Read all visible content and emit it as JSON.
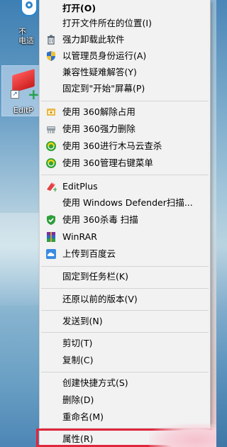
{
  "desktop": {
    "icon1_label": "不\n电适",
    "icon2_label": "EditP"
  },
  "menu": {
    "items": [
      {
        "label": "打开(O)",
        "bold": true,
        "icon": ""
      },
      {
        "label": "打开文件所在的位置(I)",
        "icon": ""
      },
      {
        "label": "强力卸载此软件",
        "icon": "trash-icon"
      },
      {
        "label": "以管理员身份运行(A)",
        "icon": "uac-shield-icon"
      },
      {
        "label": "兼容性疑难解答(Y)",
        "icon": ""
      },
      {
        "label": "固定到\"开始\"屏幕(P)",
        "icon": ""
      },
      {
        "label": "使用 360解除占用",
        "icon": "360-unlock-icon"
      },
      {
        "label": "使用 360强力删除",
        "icon": "360-shred-icon"
      },
      {
        "label": "使用 360进行木马云查杀",
        "icon": "360-scan-icon"
      },
      {
        "label": "使用 360管理右键菜单",
        "icon": "360-manage-icon"
      },
      {
        "label": "EditPlus",
        "icon": "editplus-icon"
      },
      {
        "label": "使用 Windows Defender扫描...",
        "icon": ""
      },
      {
        "label": "使用 360杀毒 扫描",
        "icon": "360-antivirus-icon"
      },
      {
        "label": "WinRAR",
        "icon": "winrar-icon"
      },
      {
        "label": "上传到百度云",
        "icon": "baidu-cloud-icon"
      },
      {
        "label": "固定到任务栏(K)",
        "icon": ""
      },
      {
        "label": "还原以前的版本(V)",
        "icon": ""
      },
      {
        "label": "发送到(N)",
        "icon": ""
      },
      {
        "label": "剪切(T)",
        "icon": ""
      },
      {
        "label": "复制(C)",
        "icon": ""
      },
      {
        "label": "创建快捷方式(S)",
        "icon": ""
      },
      {
        "label": "删除(D)",
        "icon": ""
      },
      {
        "label": "重命名(M)",
        "icon": ""
      },
      {
        "label": "属性(R)",
        "icon": ""
      }
    ]
  },
  "colors": {
    "highlight": "#e0263c",
    "menu_bg": "#f2f2f2"
  }
}
